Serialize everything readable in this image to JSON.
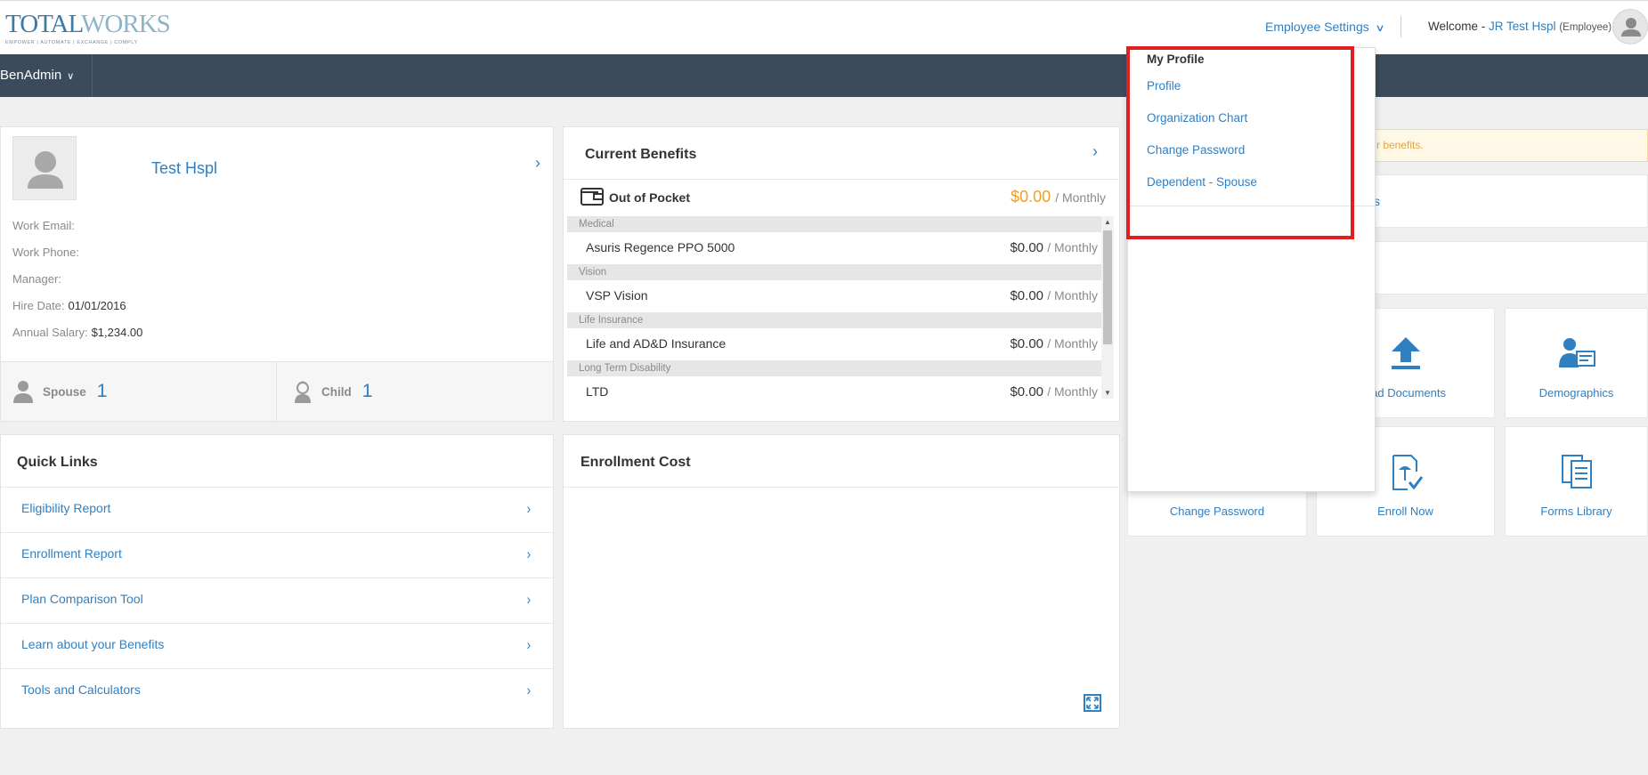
{
  "header": {
    "logo_main_a": "TOTAL",
    "logo_main_b": "WORKS",
    "logo_tagline": "EMPOWER | AUTOMATE | EXCHANGE | COMPLY",
    "employee_settings": "Employee Settings",
    "welcome_prefix": "Welcome -",
    "user_name": "JR Test Hspl",
    "user_role": "(Employee)"
  },
  "nav": {
    "ben_admin": "BenAdmin"
  },
  "profile": {
    "name": "Test Hspl",
    "fields": [
      {
        "label": "Work Email:",
        "value": ""
      },
      {
        "label": "Work Phone:",
        "value": ""
      },
      {
        "label": "Manager:",
        "value": ""
      },
      {
        "label": "Hire Date:",
        "value": "01/01/2016"
      },
      {
        "label": "Annual Salary:",
        "value": "$1,234.00"
      }
    ],
    "dependents": [
      {
        "label": "Spouse",
        "count": "1"
      },
      {
        "label": "Child",
        "count": "1"
      }
    ]
  },
  "benefits": {
    "title": "Current Benefits",
    "out_of_pocket_label": "Out of Pocket",
    "out_of_pocket_amount": "$0.00",
    "period": "/ Monthly",
    "groups": [
      {
        "category": "Medical",
        "plan": "Asuris Regence PPO 5000",
        "amount": "$0.00"
      },
      {
        "category": "Vision",
        "plan": "VSP Vision",
        "amount": "$0.00"
      },
      {
        "category": "Life Insurance",
        "plan": "Life and AD&D Insurance",
        "amount": "$0.00"
      },
      {
        "category": "Long Term Disability",
        "plan": "LTD",
        "amount": "$0.00"
      }
    ]
  },
  "quick_links": {
    "title": "Quick Links",
    "items": [
      "Eligibility Report",
      "Enrollment Report",
      "Plan Comparison Tool",
      "Learn about your Benefits",
      "Tools and Calculators"
    ]
  },
  "enrollment_cost": {
    "title": "Enrollment Cost"
  },
  "right": {
    "notice_text": "r benefits.",
    "strip_text": "s",
    "tiles": [
      {
        "label": "oad Documents",
        "icon": "upload-icon"
      },
      {
        "label": "Demographics",
        "icon": "id-card-icon"
      },
      {
        "label": "Change Password",
        "icon": "key-icon"
      },
      {
        "label": "Enroll Now",
        "icon": "enroll-icon"
      },
      {
        "label": "Forms Library",
        "icon": "documents-icon"
      }
    ]
  },
  "dropdown": {
    "header": "My Profile",
    "items": [
      "Profile",
      "Organization Chart",
      "Change Password",
      "Dependent - Spouse"
    ]
  },
  "colors": {
    "accent": "#2f7fc1",
    "navbar": "#3b4b5c",
    "money": "#f0a020",
    "highlight": "#e02020"
  }
}
